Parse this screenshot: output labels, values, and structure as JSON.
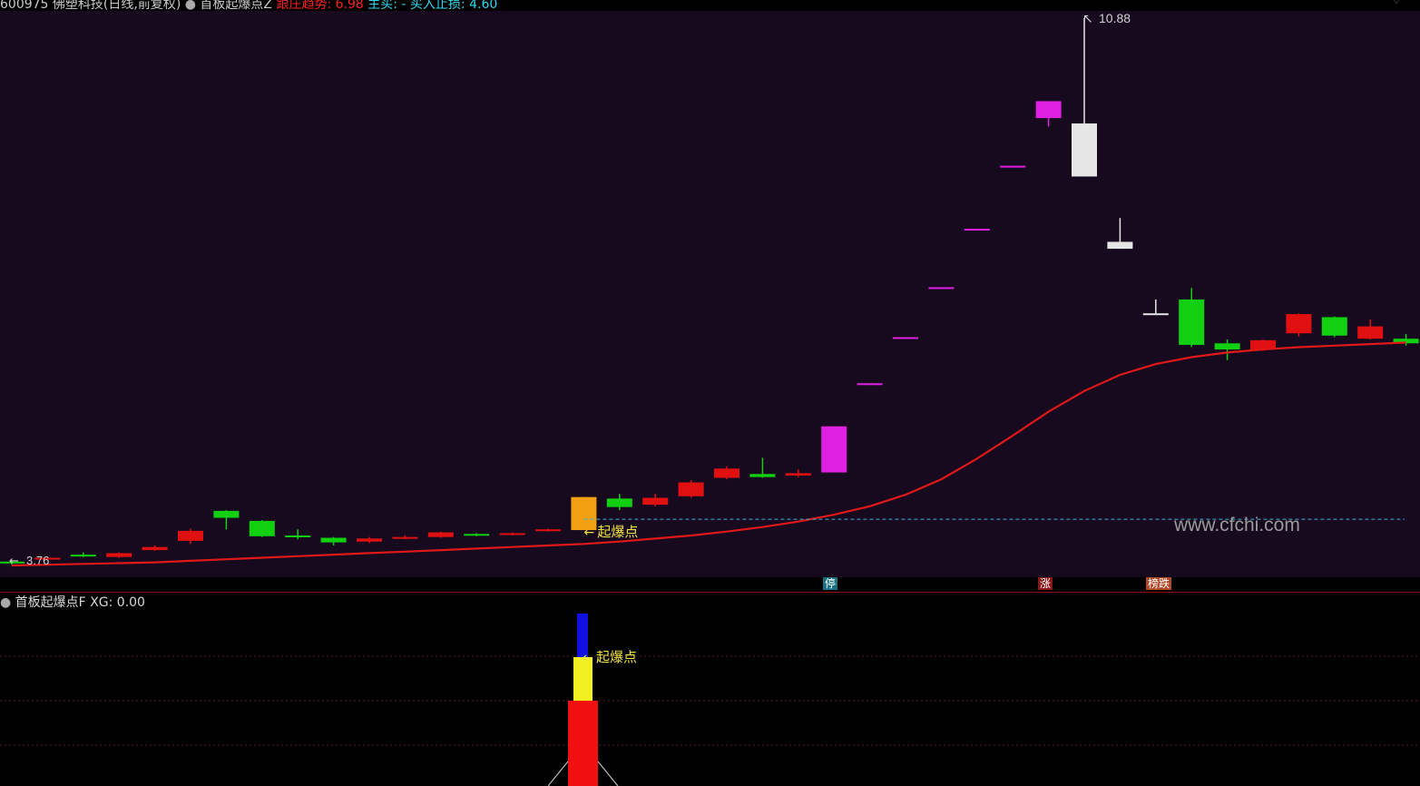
{
  "header": {
    "code": "600975",
    "stock_name": "佛塑科技(日线,前复权)",
    "indicator": "首板起爆点Z",
    "trend_label": "跟庄趋势:",
    "trend_value": "6.98",
    "buy_label": "主买:",
    "buy_value": "-",
    "stop_label": "买入止损:",
    "stop_value": "4.60"
  },
  "main_chart": {
    "bg": "#170a1f",
    "high_label": "10.88",
    "low_label": "3.76",
    "signal_label": "起爆点",
    "watermark": "www.cfchi.com",
    "colors": {
      "up": "#e01010",
      "down": "#10d010",
      "limit": "#e020e0",
      "signal": "#f0a010",
      "ma": "#e01818",
      "line": "#40b0e0"
    },
    "candles": [
      {
        "o": 3.81,
        "c": 3.79,
        "h": 3.82,
        "l": 3.77,
        "k": "down"
      },
      {
        "o": 3.84,
        "c": 3.86,
        "h": 3.87,
        "l": 3.83,
        "k": "up"
      },
      {
        "o": 3.88,
        "c": 3.9,
        "h": 3.93,
        "l": 3.87,
        "k": "down"
      },
      {
        "o": 3.87,
        "c": 3.92,
        "h": 3.93,
        "l": 3.86,
        "k": "up"
      },
      {
        "o": 3.96,
        "c": 4.0,
        "h": 4.02,
        "l": 3.95,
        "k": "up"
      },
      {
        "o": 4.08,
        "c": 4.21,
        "h": 4.24,
        "l": 4.04,
        "k": "up"
      },
      {
        "o": 4.47,
        "c": 4.38,
        "h": 4.48,
        "l": 4.23,
        "k": "down"
      },
      {
        "o": 4.34,
        "c": 4.14,
        "h": 4.35,
        "l": 4.13,
        "k": "down"
      },
      {
        "o": 4.15,
        "c": 4.13,
        "h": 4.23,
        "l": 4.1,
        "k": "down"
      },
      {
        "o": 4.12,
        "c": 4.06,
        "h": 4.13,
        "l": 4.02,
        "k": "down"
      },
      {
        "o": 4.07,
        "c": 4.11,
        "h": 4.13,
        "l": 4.05,
        "k": "up"
      },
      {
        "o": 4.11,
        "c": 4.13,
        "h": 4.15,
        "l": 4.1,
        "k": "up"
      },
      {
        "o": 4.13,
        "c": 4.19,
        "h": 4.2,
        "l": 4.12,
        "k": "up"
      },
      {
        "o": 4.17,
        "c": 4.15,
        "h": 4.18,
        "l": 4.14,
        "k": "down"
      },
      {
        "o": 4.16,
        "c": 4.18,
        "h": 4.19,
        "l": 4.15,
        "k": "up"
      },
      {
        "o": 4.21,
        "c": 4.23,
        "h": 4.24,
        "l": 4.2,
        "k": "up"
      },
      {
        "o": 4.22,
        "c": 4.65,
        "h": 4.65,
        "l": 4.22,
        "k": "signal"
      },
      {
        "o": 4.63,
        "c": 4.52,
        "h": 4.69,
        "l": 4.48,
        "k": "down"
      },
      {
        "o": 4.55,
        "c": 4.64,
        "h": 4.69,
        "l": 4.53,
        "k": "up"
      },
      {
        "o": 4.66,
        "c": 4.84,
        "h": 4.87,
        "l": 4.64,
        "k": "up"
      },
      {
        "o": 4.9,
        "c": 5.02,
        "h": 5.05,
        "l": 4.88,
        "k": "up"
      },
      {
        "o": 4.95,
        "c": 4.91,
        "h": 5.16,
        "l": 4.9,
        "k": "down"
      },
      {
        "o": 4.93,
        "c": 4.96,
        "h": 5.01,
        "l": 4.91,
        "k": "up"
      },
      {
        "o": 4.97,
        "c": 5.57,
        "h": 5.57,
        "l": 4.97,
        "k": "limit"
      },
      {
        "o": 6.13,
        "c": 6.13,
        "h": 6.13,
        "l": 6.13,
        "k": "limit"
      },
      {
        "o": 6.73,
        "c": 6.73,
        "h": 6.73,
        "l": 6.73,
        "k": "limit"
      },
      {
        "o": 7.38,
        "c": 7.38,
        "h": 7.38,
        "l": 7.38,
        "k": "limit"
      },
      {
        "o": 8.14,
        "c": 8.14,
        "h": 8.14,
        "l": 8.14,
        "k": "limit"
      },
      {
        "o": 8.96,
        "c": 8.96,
        "h": 8.96,
        "l": 8.96,
        "k": "limit"
      },
      {
        "o": 9.58,
        "c": 9.8,
        "h": 9.8,
        "l": 9.47,
        "k": "limit"
      },
      {
        "o": 9.51,
        "c": 8.82,
        "h": 10.88,
        "l": 8.82,
        "k": "white"
      },
      {
        "o": 7.97,
        "c": 7.88,
        "h": 8.28,
        "l": 7.88,
        "k": "white"
      },
      {
        "o": 7.04,
        "c": 7.04,
        "h": 7.22,
        "l": 7.04,
        "k": "white"
      },
      {
        "o": 7.22,
        "c": 6.63,
        "h": 7.37,
        "l": 6.6,
        "k": "down"
      },
      {
        "o": 6.65,
        "c": 6.57,
        "h": 6.7,
        "l": 6.43,
        "k": "down"
      },
      {
        "o": 6.57,
        "c": 6.69,
        "h": 6.7,
        "l": 6.55,
        "k": "up"
      },
      {
        "o": 6.78,
        "c": 7.03,
        "h": 7.04,
        "l": 6.74,
        "k": "up"
      },
      {
        "o": 6.99,
        "c": 6.75,
        "h": 7.0,
        "l": 6.73,
        "k": "down"
      },
      {
        "o": 6.71,
        "c": 6.87,
        "h": 6.96,
        "l": 6.7,
        "k": "up"
      },
      {
        "o": 6.71,
        "c": 6.65,
        "h": 6.77,
        "l": 6.62,
        "k": "down"
      }
    ],
    "ma": [
      3.76,
      3.77,
      3.78,
      3.79,
      3.8,
      3.82,
      3.84,
      3.86,
      3.88,
      3.9,
      3.92,
      3.94,
      3.96,
      3.98,
      4.0,
      4.02,
      4.04,
      4.07,
      4.11,
      4.15,
      4.2,
      4.26,
      4.33,
      4.42,
      4.53,
      4.68,
      4.88,
      5.15,
      5.45,
      5.76,
      6.03,
      6.24,
      6.38,
      6.47,
      6.53,
      6.57,
      6.6,
      6.62,
      6.64,
      6.66
    ]
  },
  "markers": [
    {
      "label": "停",
      "bg": "#1a7080"
    },
    {
      "label": "涨",
      "bg": "#8a1818"
    },
    {
      "label": "榜跌",
      "bg": "#b04828"
    }
  ],
  "sub": {
    "title": "首板起爆点F",
    "xg_label": "XG:",
    "xg_value": "0.00",
    "signal_label": "起爆点"
  }
}
